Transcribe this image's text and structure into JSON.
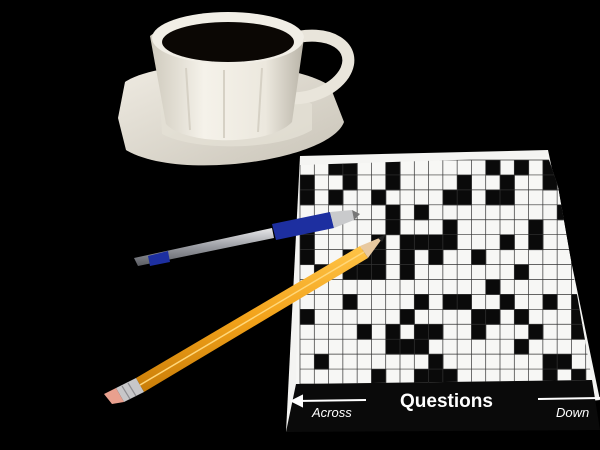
{
  "scene": {
    "background_color": "#000000",
    "objects": [
      "coffee-cup",
      "saucer",
      "crossword-booklet",
      "ballpoint-pen",
      "pencil"
    ]
  },
  "crossword": {
    "footer": {
      "across_label": "Across",
      "title": "Questions",
      "down_label": "Down"
    }
  },
  "colors": {
    "paper": "#f4f4f2",
    "grid_black": "#0a0a0a",
    "pen_blue": "#1d2fa0",
    "pencil_yellow": "#f2a21a",
    "eraser_pink": "#e9a08e",
    "coffee": "#0b0704"
  }
}
